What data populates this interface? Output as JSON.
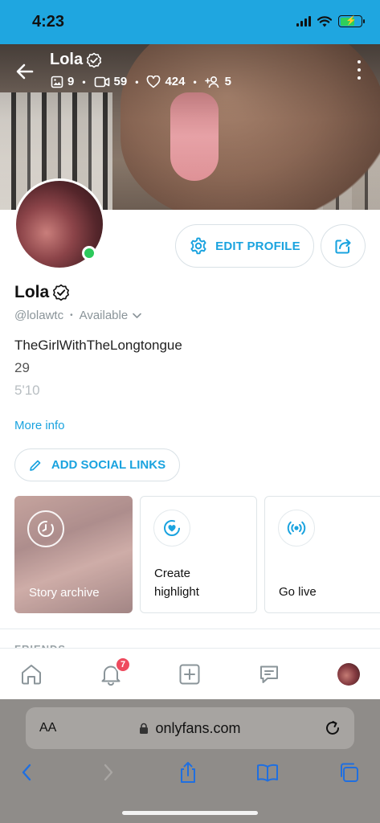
{
  "status_bar": {
    "time": "4:23"
  },
  "cover": {
    "name": "Lola",
    "stats": {
      "photos": "9",
      "videos": "59",
      "likes": "424",
      "subscribers": "5"
    }
  },
  "profile": {
    "edit_label": "EDIT PROFILE",
    "name": "Lola",
    "handle": "@lolawtc",
    "availability": "Available",
    "bio_lines": [
      "TheGirlWithTheLongtongue",
      "29",
      "5'10"
    ],
    "more_info": "More info",
    "social_label": "ADD SOCIAL LINKS"
  },
  "cards": {
    "archive": "Story archive",
    "highlight_line1": "Create",
    "highlight_line2": "highlight",
    "live": "Go live"
  },
  "friends_label": "FRIENDS",
  "bottom_nav": {
    "notification_count": "7"
  },
  "browser": {
    "aa": "AA",
    "url": "onlyfans.com"
  },
  "colors": {
    "accent": "#1aa3df",
    "status_bar": "#1fa6e0",
    "online": "#2cc95b",
    "badge": "#ee4a5e"
  }
}
